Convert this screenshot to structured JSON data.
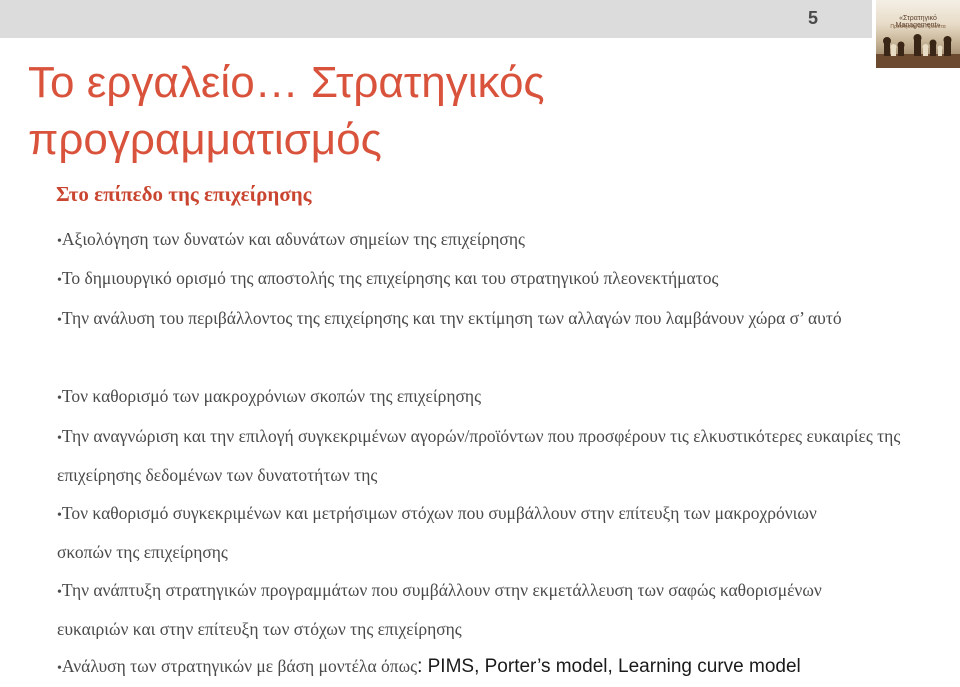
{
  "slide_number": "5",
  "logo": {
    "line1": "«Στρατηγικό Management»",
    "line2": "Προκλήσεις και Πρόοπτα"
  },
  "title": "Το εργαλείο… Στρατηγικός προγραμματισμός",
  "subtitle": "Στο επίπεδο της επιχείρησης",
  "bullet_marker": "•",
  "bullets": [
    "Αξιολόγηση των δυνατών και αδυνάτων σημείων της επιχείρησης",
    "Το δημιουργικό ορισμό της αποστολής της επιχείρησης και του στρατηγικού πλεονεκτήματος",
    "Την ανάλυση του περιβάλλοντος της επιχείρησης και την εκτίμηση των αλλαγών που λαμβάνουν χώρα σ’ αυτό",
    "Τον καθορισμό των μακροχρόνιων σκοπών της επιχείρησης",
    "Την αναγνώριση και την επιλογή συγκεκριμένων αγορών/προϊόντων που  προσφέρουν τις ελκυστικότερες ευκαιρίες της επιχείρησης δεδομένων των δυνατοτήτων της",
    "Τον καθορισμό συγκεκριμένων και μετρήσιμων στόχων που συμβάλλουν στην επίτευξη των μακροχρόνιων σκοπών της επιχείρησης",
    "Την ανάπτυξη στρατηγικών προγραμμάτων που συμβάλλουν στην εκμετάλλευση των σαφώς καθορισμένων ευκαιριών  και στην επίτευξη των στόχων της επιχείρησης"
  ],
  "last_bullet": {
    "greek": "Ανάλυση των στρατηγικών με βάση μοντέλα όπως",
    "models": ": PIMS, Porter’s model, Learning curve model"
  }
}
